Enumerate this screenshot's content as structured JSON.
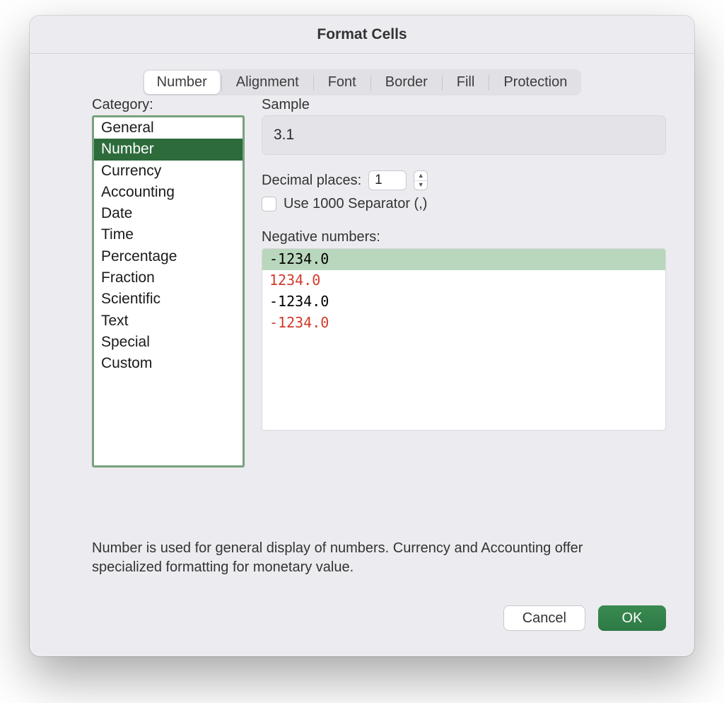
{
  "dialog": {
    "title": "Format Cells",
    "tabs": [
      "Number",
      "Alignment",
      "Font",
      "Border",
      "Fill",
      "Protection"
    ],
    "active_tab_index": 0,
    "description": "Number is used for general display of numbers.  Currency and Accounting offer specialized formatting for monetary value.",
    "buttons": {
      "cancel": "Cancel",
      "ok": "OK"
    }
  },
  "category": {
    "label": "Category:",
    "items": [
      "General",
      "Number",
      "Currency",
      "Accounting",
      "Date",
      "Time",
      "Percentage",
      "Fraction",
      "Scientific",
      "Text",
      "Special",
      "Custom"
    ],
    "selected_index": 1
  },
  "sample": {
    "label": "Sample",
    "value": "3.1"
  },
  "decimal": {
    "label": "Decimal places:",
    "value": "1"
  },
  "separator": {
    "label": "Use 1000 Separator (,)",
    "checked": false
  },
  "negative": {
    "label": "Negative numbers:",
    "items": [
      {
        "text": "-1234.0",
        "color": "black"
      },
      {
        "text": "1234.0",
        "color": "red"
      },
      {
        "text": "-1234.0",
        "color": "black"
      },
      {
        "text": "-1234.0",
        "color": "red"
      }
    ],
    "selected_index": 0
  }
}
